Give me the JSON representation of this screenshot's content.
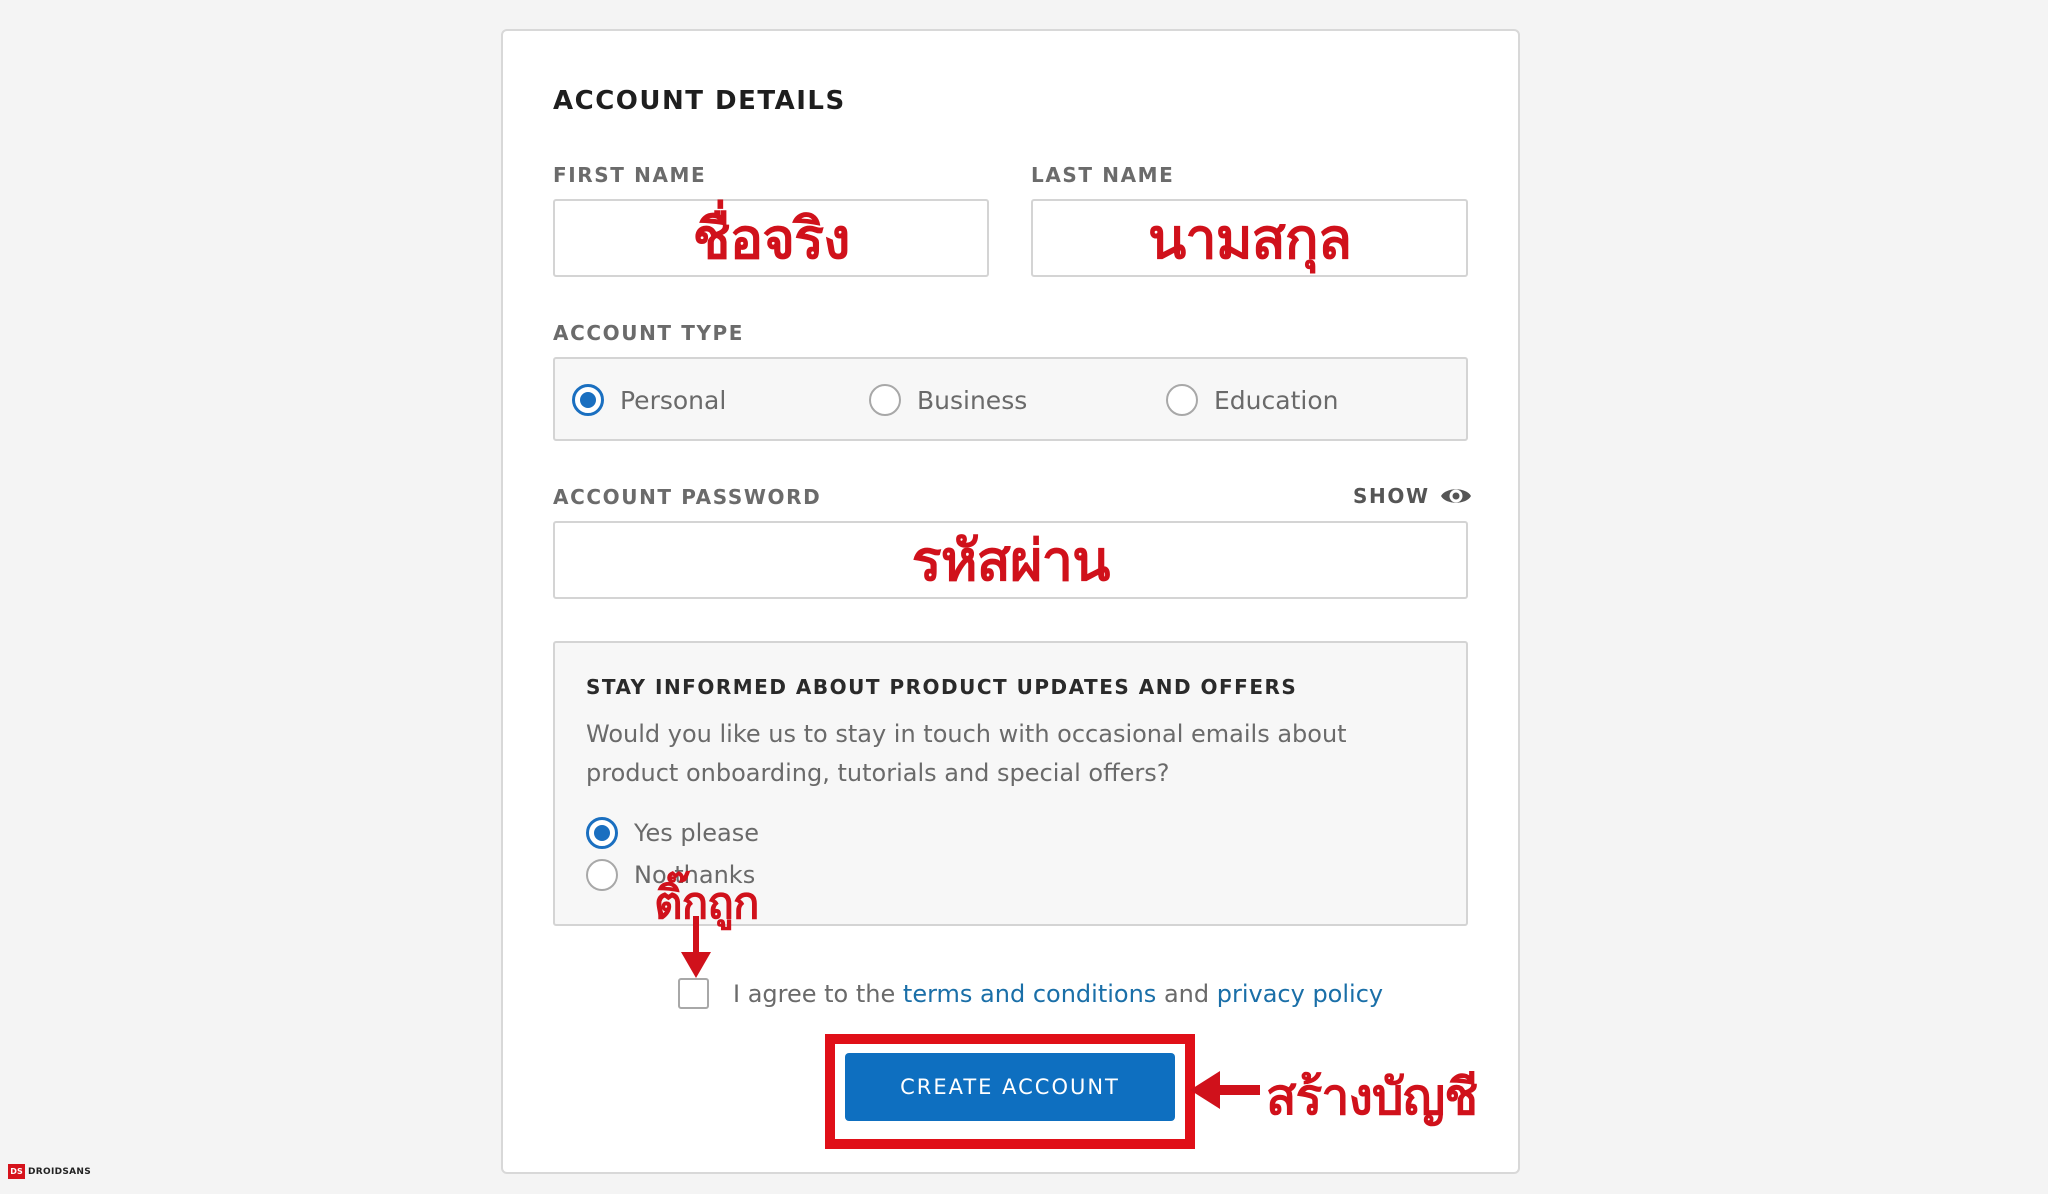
{
  "form": {
    "title": "ACCOUNT DETAILS",
    "first_name": {
      "label": "FIRST NAME",
      "annotation": "ชื่อจริง"
    },
    "last_name": {
      "label": "LAST NAME",
      "annotation": "นามสกุล"
    },
    "account_type": {
      "label": "ACCOUNT TYPE",
      "options": [
        {
          "label": "Personal",
          "checked": true
        },
        {
          "label": "Business",
          "checked": false
        },
        {
          "label": "Education",
          "checked": false
        }
      ]
    },
    "password": {
      "label": "ACCOUNT PASSWORD",
      "show_label": "SHOW",
      "annotation": "รหัสผ่าน"
    },
    "updates": {
      "title": "STAY INFORMED ABOUT PRODUCT UPDATES AND OFFERS",
      "description": "Would you like us to stay in touch with occasional emails about product onboarding, tutorials and special offers?",
      "options": [
        {
          "label": "Yes please",
          "checked": true
        },
        {
          "label": "No thanks",
          "checked": false
        }
      ]
    },
    "agree": {
      "prefix": "I agree to the",
      "terms_link": "terms and conditions",
      "middle": "and",
      "privacy_link": "privacy policy"
    },
    "submit_label": "CREATE ACCOUNT"
  },
  "annotations": {
    "check_here": "ติ๊กถูก",
    "create_account": "สร้างบัญชี",
    "color": "#d0111b"
  },
  "watermark": {
    "logo": "DS",
    "text": "DROIDSANS"
  },
  "colors": {
    "accent": "#1a6fc0",
    "button": "#0e6fc0",
    "link": "#1a6fa8",
    "highlight": "#e00f18"
  }
}
